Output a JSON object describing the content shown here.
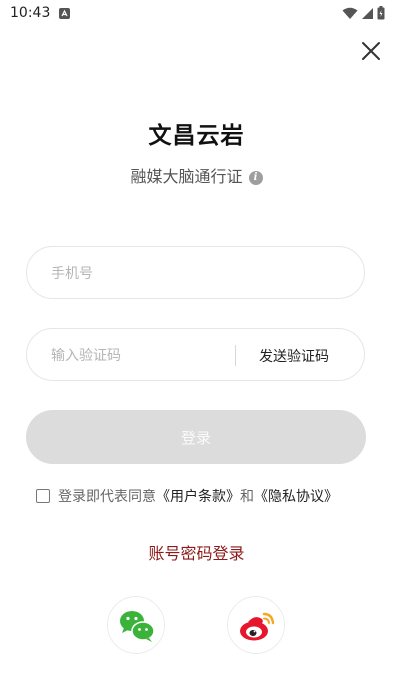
{
  "status_bar": {
    "time": "10:43"
  },
  "app": {
    "title": "文昌云岩",
    "subtitle": "融媒大脑通行证"
  },
  "form": {
    "phone_placeholder": "手机号",
    "code_placeholder": "输入验证码",
    "send_code_label": "发送验证码",
    "login_label": "登录"
  },
  "agreement": {
    "prefix": "登录即代表同意",
    "user_terms": "《用户条款》",
    "and": "和",
    "privacy": "《隐私协议》"
  },
  "password_login_label": "账号密码登录",
  "colors": {
    "accent": "#8b1a1a",
    "login_disabled_bg": "#dcdcdc",
    "wechat_green": "#3bb33b",
    "weibo_red": "#e6162d",
    "weibo_orange": "#f5a623"
  },
  "icons": [
    "close-icon",
    "info-icon",
    "wechat-icon",
    "weibo-icon",
    "wifi-icon",
    "signal-icon",
    "battery-icon"
  ]
}
